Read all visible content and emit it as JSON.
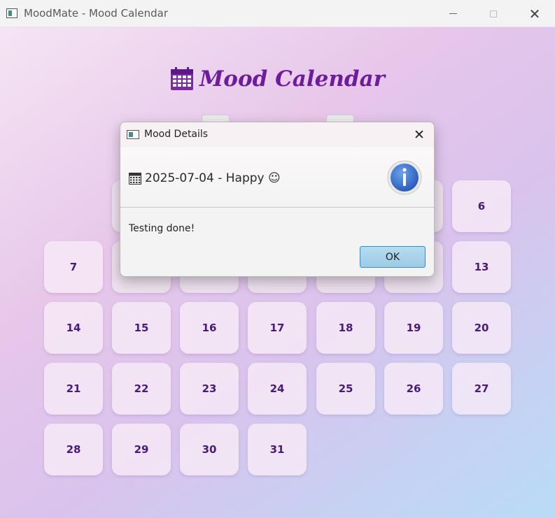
{
  "window": {
    "title": "MoodMate - Mood Calendar",
    "controls": {
      "minimize": "minimize",
      "maximize": "maximize",
      "close": "✕"
    }
  },
  "calendar": {
    "heading": "Mood Calendar",
    "heading_icon": "calendar-icon",
    "colors": {
      "heading": "#6d1d9c",
      "day_text": "#4a1a7a"
    },
    "days": [
      {
        "label": "6"
      },
      {
        "label": "7"
      },
      {
        "label": "13"
      },
      {
        "label": "14"
      },
      {
        "label": "15"
      },
      {
        "label": "16"
      },
      {
        "label": "17"
      },
      {
        "label": "18"
      },
      {
        "label": "19"
      },
      {
        "label": "20"
      },
      {
        "label": "21"
      },
      {
        "label": "22"
      },
      {
        "label": "23"
      },
      {
        "label": "24"
      },
      {
        "label": "25"
      },
      {
        "label": "26"
      },
      {
        "label": "27"
      },
      {
        "label": "28"
      },
      {
        "label": "29"
      },
      {
        "label": "30"
      },
      {
        "label": "31"
      }
    ]
  },
  "dialog": {
    "title": "Mood Details",
    "close_label": "✕",
    "header_icon": "calendar-icon",
    "header_text": "2025-07-04 - Happy ☺",
    "status_icon": "info-icon",
    "message": "Testing done!",
    "ok_label": "OK",
    "colors": {
      "ok_border": "#2f8fc6",
      "info": "#2f6fc9"
    }
  }
}
